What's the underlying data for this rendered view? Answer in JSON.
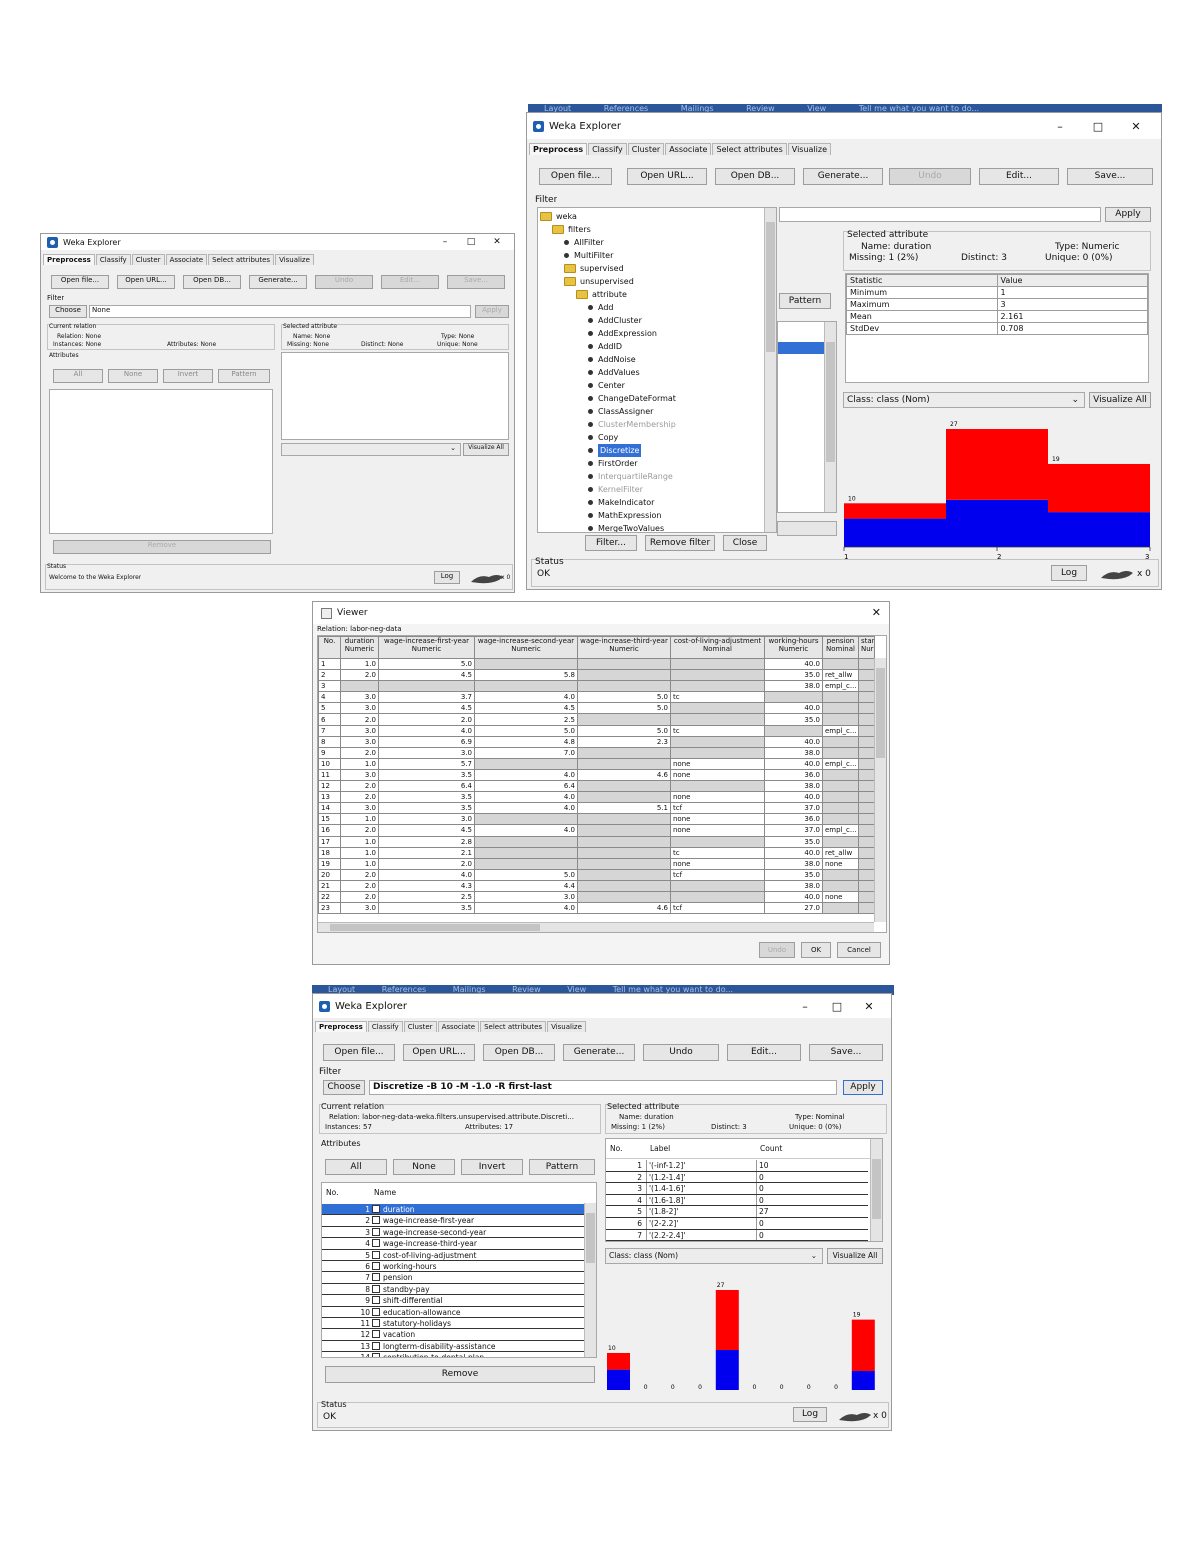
{
  "w1": {
    "title": "Weka Explorer",
    "tabs": [
      "Preprocess",
      "Classify",
      "Cluster",
      "Associate",
      "Select attributes",
      "Visualize"
    ],
    "buttons": [
      "Open file...",
      "Open URL...",
      "Open DB...",
      "Generate...",
      "Undo",
      "Edit...",
      "Save..."
    ],
    "filter_label": "Filter",
    "choose": "Choose",
    "filter_value": "None",
    "apply": "Apply",
    "current_relation": "Current relation",
    "relation": "Relation: None",
    "instances": "Instances: None",
    "attributes_count": "Attributes: None",
    "attributes_label": "Attributes",
    "attr_buttons": [
      "All",
      "None",
      "Invert",
      "Pattern"
    ],
    "remove": "Remove",
    "selected_attribute": "Selected attribute",
    "name": "Name: None",
    "missing": "Missing: None",
    "distinct": "Distinct: None",
    "type": "Type: None",
    "unique": "Unique: None",
    "visualize_all": "Visualize All",
    "status_label": "Status",
    "status": "Welcome to the Weka Explorer",
    "log": "Log",
    "x0": "x 0"
  },
  "w2": {
    "ribbon": [
      "Layout",
      "References",
      "Mailings",
      "Review",
      "View",
      "Tell me what you want to do..."
    ],
    "title": "Weka Explorer",
    "tabs": [
      "Preprocess",
      "Classify",
      "Cluster",
      "Associate",
      "Select attributes",
      "Visualize"
    ],
    "buttons": [
      "Open file...",
      "Open URL...",
      "Open DB...",
      "Generate...",
      "Undo",
      "Edit...",
      "Save..."
    ],
    "filter_label": "Filter",
    "apply": "Apply",
    "tree": [
      {
        "label": "weka",
        "kind": "folder",
        "depth": 0
      },
      {
        "label": "filters",
        "kind": "folder",
        "depth": 1
      },
      {
        "label": "AllFilter",
        "kind": "leaf",
        "depth": 2
      },
      {
        "label": "MultiFilter",
        "kind": "leaf",
        "depth": 2
      },
      {
        "label": "supervised",
        "kind": "folder",
        "depth": 2
      },
      {
        "label": "unsupervised",
        "kind": "folder",
        "depth": 2
      },
      {
        "label": "attribute",
        "kind": "folder",
        "depth": 3
      },
      {
        "label": "Add",
        "kind": "leaf",
        "depth": 4
      },
      {
        "label": "AddCluster",
        "kind": "leaf",
        "depth": 4
      },
      {
        "label": "AddExpression",
        "kind": "leaf",
        "depth": 4
      },
      {
        "label": "AddID",
        "kind": "leaf",
        "depth": 4
      },
      {
        "label": "AddNoise",
        "kind": "leaf",
        "depth": 4
      },
      {
        "label": "AddValues",
        "kind": "leaf",
        "depth": 4
      },
      {
        "label": "Center",
        "kind": "leaf",
        "depth": 4
      },
      {
        "label": "ChangeDateFormat",
        "kind": "leaf",
        "depth": 4
      },
      {
        "label": "ClassAssigner",
        "kind": "leaf",
        "depth": 4
      },
      {
        "label": "ClusterMembership",
        "kind": "leaf",
        "depth": 4,
        "disabled": true
      },
      {
        "label": "Copy",
        "kind": "leaf",
        "depth": 4
      },
      {
        "label": "Discretize",
        "kind": "leaf",
        "depth": 4,
        "selected": true
      },
      {
        "label": "FirstOrder",
        "kind": "leaf",
        "depth": 4
      },
      {
        "label": "InterquartileRange",
        "kind": "leaf",
        "depth": 4,
        "disabled": true
      },
      {
        "label": "KernelFilter",
        "kind": "leaf",
        "depth": 4,
        "disabled": true
      },
      {
        "label": "MakeIndicator",
        "kind": "leaf",
        "depth": 4
      },
      {
        "label": "MathExpression",
        "kind": "leaf",
        "depth": 4
      },
      {
        "label": "MergeTwoValues",
        "kind": "leaf",
        "depth": 4
      }
    ],
    "tree_buttons": [
      "Filter...",
      "Remove filter",
      "Close"
    ],
    "pattern": "Pattern",
    "selected_attribute": "Selected attribute",
    "name": "Name: duration",
    "missing": "Missing: 1 (2%)",
    "distinct": "Distinct: 3",
    "type": "Type: Numeric",
    "unique": "Unique: 0 (0%)",
    "stats_headers": [
      "Statistic",
      "Value"
    ],
    "stats": [
      [
        "Minimum",
        "1"
      ],
      [
        "Maximum",
        "3"
      ],
      [
        "Mean",
        "2.161"
      ],
      [
        "StdDev",
        "0.708"
      ]
    ],
    "class_select": "Class: class (Nom)",
    "visualize_all": "Visualize All",
    "hist": [
      {
        "label": "10",
        "red": 0.35,
        "blue": 0.65
      },
      {
        "label": "27",
        "red": 0.6,
        "blue": 0.4
      },
      {
        "label": "19",
        "red": 0.58,
        "blue": 0.42
      }
    ],
    "axis": [
      "1",
      "2",
      "3"
    ],
    "status_label": "Status",
    "status": "OK",
    "log": "Log",
    "x0": "x 0"
  },
  "viewer": {
    "title": "Viewer",
    "relation": "Relation: labor-neg-data",
    "headers": [
      {
        "name": "No.",
        "type": ""
      },
      {
        "name": "duration",
        "type": "Numeric"
      },
      {
        "name": "wage-increase-first-year",
        "type": "Numeric"
      },
      {
        "name": "wage-increase-second-year",
        "type": "Numeric"
      },
      {
        "name": "wage-increase-third-year",
        "type": "Numeric"
      },
      {
        "name": "cost-of-living-adjustment",
        "type": "Nominal"
      },
      {
        "name": "working-hours",
        "type": "Numeric"
      },
      {
        "name": "pension",
        "type": "Nominal"
      },
      {
        "name": "standb",
        "type": "Nur"
      }
    ],
    "rows": [
      [
        "1",
        "1.0",
        "5.0",
        "",
        "",
        "",
        "40.0",
        "",
        ""
      ],
      [
        "2",
        "2.0",
        "4.5",
        "5.8",
        "",
        "",
        "35.0",
        "ret_allw",
        ""
      ],
      [
        "3",
        "",
        "",
        "",
        "",
        "",
        "38.0",
        "empl_c...",
        ""
      ],
      [
        "4",
        "3.0",
        "3.7",
        "4.0",
        "5.0",
        "tc",
        "",
        "",
        ""
      ],
      [
        "5",
        "3.0",
        "4.5",
        "4.5",
        "5.0",
        "",
        "40.0",
        "",
        ""
      ],
      [
        "6",
        "2.0",
        "2.0",
        "2.5",
        "",
        "",
        "35.0",
        "",
        ""
      ],
      [
        "7",
        "3.0",
        "4.0",
        "5.0",
        "5.0",
        "tc",
        "",
        "empl_c...",
        ""
      ],
      [
        "8",
        "3.0",
        "6.9",
        "4.8",
        "2.3",
        "",
        "40.0",
        "",
        ""
      ],
      [
        "9",
        "2.0",
        "3.0",
        "7.0",
        "",
        "",
        "38.0",
        "",
        ""
      ],
      [
        "10",
        "1.0",
        "5.7",
        "",
        "",
        "none",
        "40.0",
        "empl_c...",
        ""
      ],
      [
        "11",
        "3.0",
        "3.5",
        "4.0",
        "4.6",
        "none",
        "36.0",
        "",
        ""
      ],
      [
        "12",
        "2.0",
        "6.4",
        "6.4",
        "",
        "",
        "38.0",
        "",
        ""
      ],
      [
        "13",
        "2.0",
        "3.5",
        "4.0",
        "",
        "none",
        "40.0",
        "",
        ""
      ],
      [
        "14",
        "3.0",
        "3.5",
        "4.0",
        "5.1",
        "tcf",
        "37.0",
        "",
        ""
      ],
      [
        "15",
        "1.0",
        "3.0",
        "",
        "",
        "none",
        "36.0",
        "",
        ""
      ],
      [
        "16",
        "2.0",
        "4.5",
        "4.0",
        "",
        "none",
        "37.0",
        "empl_c...",
        ""
      ],
      [
        "17",
        "1.0",
        "2.8",
        "",
        "",
        "",
        "35.0",
        "",
        ""
      ],
      [
        "18",
        "1.0",
        "2.1",
        "",
        "",
        "tc",
        "40.0",
        "ret_allw",
        ""
      ],
      [
        "19",
        "1.0",
        "2.0",
        "",
        "",
        "none",
        "38.0",
        "none",
        ""
      ],
      [
        "20",
        "2.0",
        "4.0",
        "5.0",
        "",
        "tcf",
        "35.0",
        "",
        ""
      ],
      [
        "21",
        "2.0",
        "4.3",
        "4.4",
        "",
        "",
        "38.0",
        "",
        ""
      ],
      [
        "22",
        "2.0",
        "2.5",
        "3.0",
        "",
        "",
        "40.0",
        "none",
        ""
      ],
      [
        "23",
        "3.0",
        "3.5",
        "4.0",
        "4.6",
        "tcf",
        "27.0",
        "",
        ""
      ]
    ],
    "buttons": [
      "Undo",
      "OK",
      "Cancel"
    ]
  },
  "w3": {
    "ribbon": [
      "Layout",
      "References",
      "Mailings",
      "Review",
      "View",
      "Tell me what you want to do..."
    ],
    "title": "Weka Explorer",
    "tabs": [
      "Preprocess",
      "Classify",
      "Cluster",
      "Associate",
      "Select attributes",
      "Visualize"
    ],
    "buttons": [
      "Open file...",
      "Open URL...",
      "Open DB...",
      "Generate...",
      "Undo",
      "Edit...",
      "Save..."
    ],
    "filter_label": "Filter",
    "choose": "Choose",
    "filter_value": "Discretize -B 10 -M -1.0 -R first-last",
    "apply": "Apply",
    "current_relation": "Current relation",
    "relation": "Relation: labor-neg-data-weka.filters.unsupervised.attribute.Discreti...",
    "instances": "Instances: 57",
    "attributes_count": "Attributes: 17",
    "attributes_label": "Attributes",
    "attr_buttons": [
      "All",
      "None",
      "Invert",
      "Pattern"
    ],
    "attr_headers": [
      "No.",
      "Name"
    ],
    "attributes": [
      [
        "1",
        "duration"
      ],
      [
        "2",
        "wage-increase-first-year"
      ],
      [
        "3",
        "wage-increase-second-year"
      ],
      [
        "4",
        "wage-increase-third-year"
      ],
      [
        "5",
        "cost-of-living-adjustment"
      ],
      [
        "6",
        "working-hours"
      ],
      [
        "7",
        "pension"
      ],
      [
        "8",
        "standby-pay"
      ],
      [
        "9",
        "shift-differential"
      ],
      [
        "10",
        "education-allowance"
      ],
      [
        "11",
        "statutory-holidays"
      ],
      [
        "12",
        "vacation"
      ],
      [
        "13",
        "longterm-disability-assistance"
      ],
      [
        "14",
        "contribution-to-dental-plan"
      ]
    ],
    "remove": "Remove",
    "selected_attribute": "Selected attribute",
    "name": "Name: duration",
    "missing": "Missing: 1 (2%)",
    "distinct": "Distinct: 3",
    "type": "Type: Nominal",
    "unique": "Unique: 0 (0%)",
    "label_headers": [
      "No.",
      "Label",
      "Count"
    ],
    "labels": [
      [
        "1",
        "'(-inf-1.2]'",
        "10"
      ],
      [
        "2",
        "'(1.2-1.4]'",
        "0"
      ],
      [
        "3",
        "'(1.4-1.6]'",
        "0"
      ],
      [
        "4",
        "'(1.6-1.8]'",
        "0"
      ],
      [
        "5",
        "'(1.8-2]'",
        "27"
      ],
      [
        "6",
        "'(2-2.2]'",
        "0"
      ],
      [
        "7",
        "'(2.2-2.4]'",
        "0"
      ]
    ],
    "class_select": "Class: class (Nom)",
    "visualize_all": "Visualize All",
    "hist": [
      {
        "label": "10",
        "count": 10,
        "red": 0.45,
        "blue": 0.55
      },
      {
        "label": "0",
        "count": 0
      },
      {
        "label": "0",
        "count": 0
      },
      {
        "label": "0",
        "count": 0
      },
      {
        "label": "27",
        "count": 27,
        "red": 0.6,
        "blue": 0.4
      },
      {
        "label": "0",
        "count": 0
      },
      {
        "label": "0",
        "count": 0
      },
      {
        "label": "0",
        "count": 0
      },
      {
        "label": "0",
        "count": 0
      },
      {
        "label": "19",
        "count": 19,
        "red": 0.73,
        "blue": 0.27
      }
    ],
    "status_label": "Status",
    "status": "OK",
    "log": "Log",
    "x0": "x 0"
  },
  "colors": {
    "red": "#ff0000",
    "blue": "#0000ee",
    "selection": "#3370d6"
  }
}
